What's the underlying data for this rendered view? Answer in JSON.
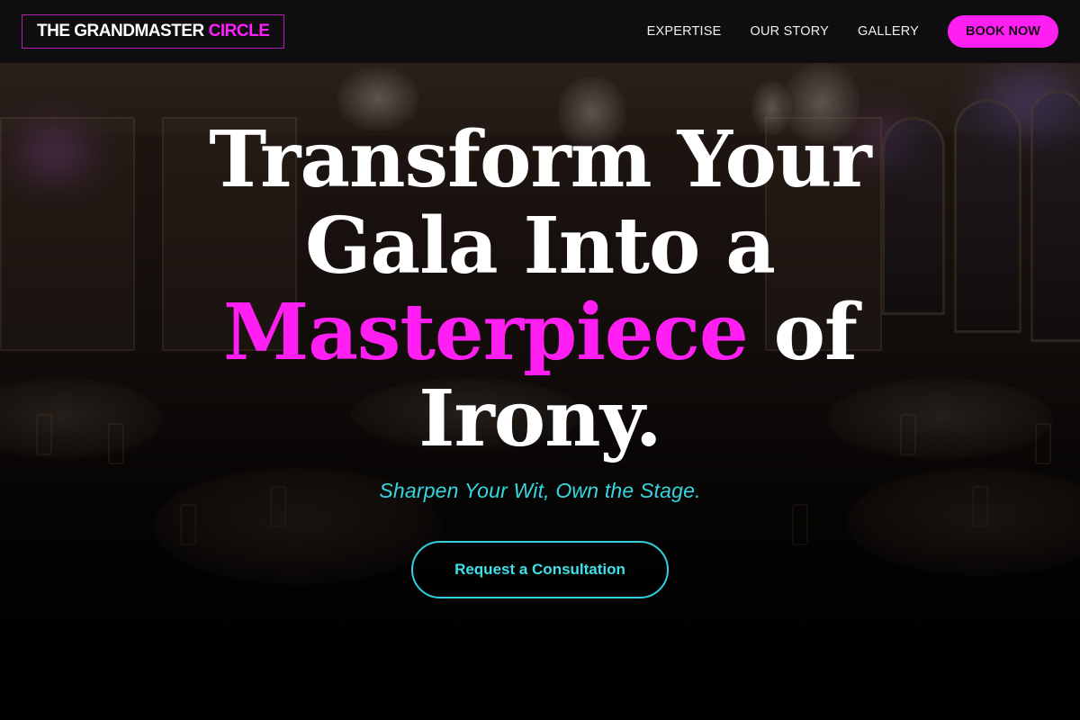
{
  "nav": {
    "logo_main": "THE GRANDMASTER",
    "logo_accent": "CIRCLE",
    "links": [
      "EXPERTISE",
      "OUR STORY",
      "GALLERY"
    ],
    "cta_label": "BOOK NOW"
  },
  "hero": {
    "headline_line1": "Transform Your",
    "headline_line2": "Gala Into a",
    "headline_highlight": "Masterpiece",
    "headline_line3_rest": "of",
    "headline_line4": "Irony.",
    "tagline": "Sharpen Your Wit, Own the Stage.",
    "cta_label": "Request a Consultation"
  },
  "colors": {
    "accent_pink": "#ff1ff2",
    "accent_cyan": "#2fd2dc",
    "nav_bg": "#0c0c0e"
  }
}
